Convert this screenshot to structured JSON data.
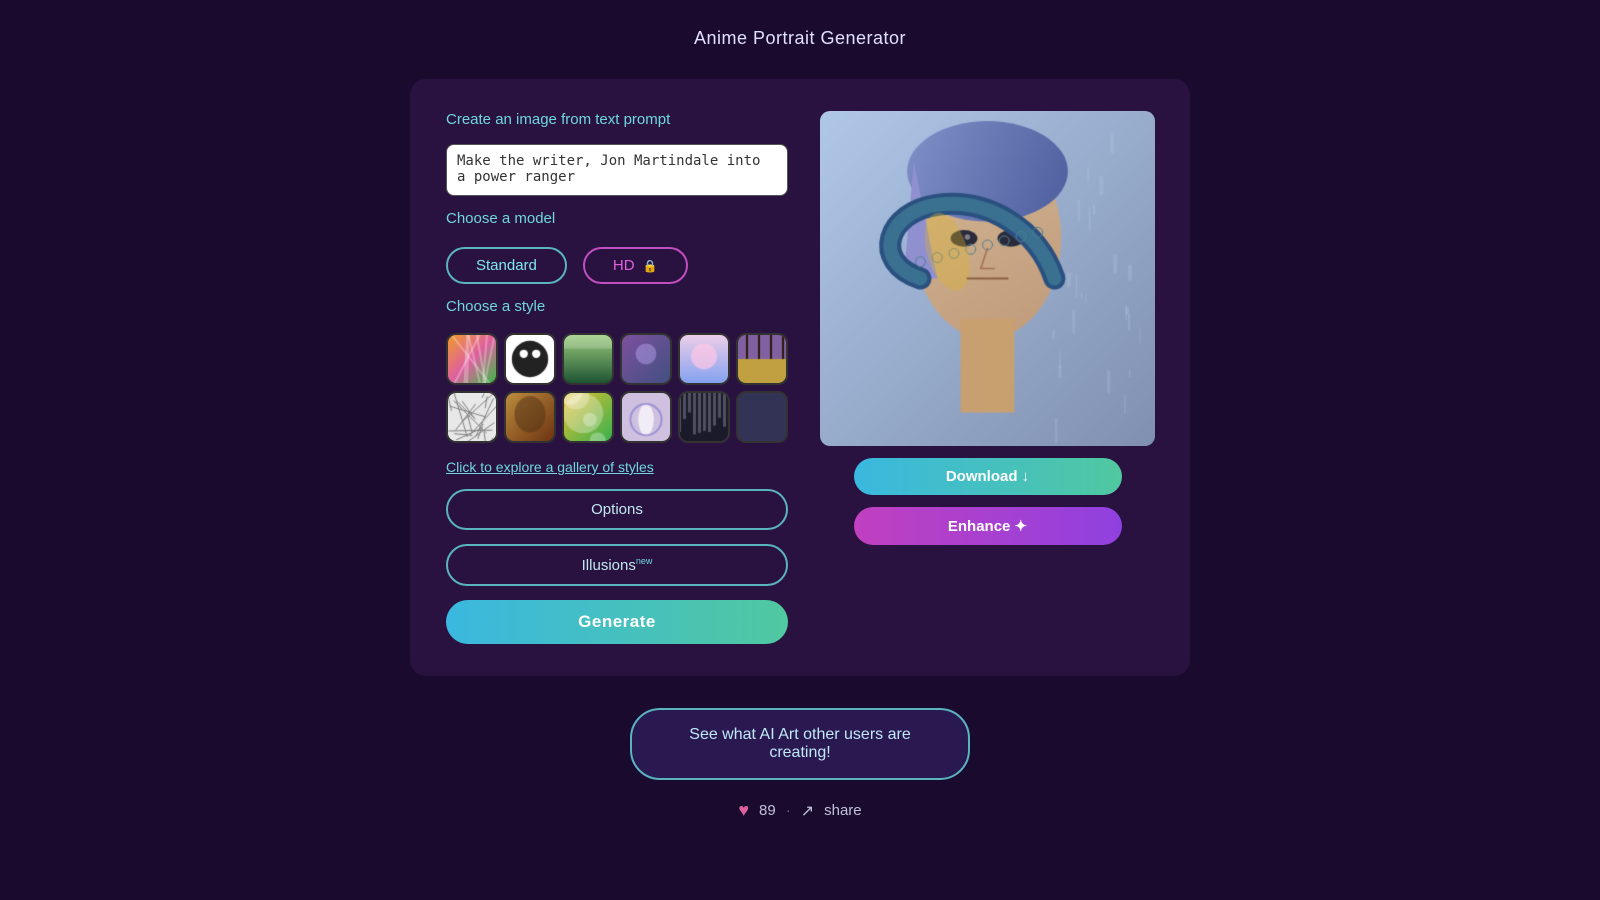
{
  "page": {
    "title": "Anime Portrait Generator"
  },
  "header": {
    "title": "Anime Portrait Generator"
  },
  "form": {
    "section_prompt": "Create an image from text prompt",
    "prompt_value": "Make the writer, Jon Martindale into a power ranger",
    "prompt_placeholder": "Make the writer, Jon Martindale into a power ranger",
    "section_model": "Choose a model",
    "model_standard_label": "Standard",
    "model_hd_label": "HD",
    "model_hd_lock": "🔒",
    "section_style": "Choose a style",
    "gallery_link": "Click to explore a gallery of styles",
    "options_label": "Options",
    "illusions_label": "Illusions",
    "illusions_sup": "new",
    "generate_label": "Generate"
  },
  "output": {
    "download_label": "Download ↓",
    "enhance_label": "Enhance ✦"
  },
  "bottom": {
    "community_label": "See what AI Art other users are creating!",
    "like_count": "89",
    "share_label": "share"
  },
  "styles": [
    {
      "name": "colorful-abstract",
      "color1": "#f0a020",
      "color2": "#30c040"
    },
    {
      "name": "panda",
      "color1": "#ffffff",
      "color2": "#222222"
    },
    {
      "name": "forest",
      "color1": "#2a8040",
      "color2": "#1a5030"
    },
    {
      "name": "warrior",
      "color1": "#8050a0",
      "color2": "#405080"
    },
    {
      "name": "anime-girl",
      "color1": "#f0c0e0",
      "color2": "#80a0f0"
    },
    {
      "name": "castle",
      "color1": "#c0a080",
      "color2": "#806040"
    },
    {
      "name": "sketch-city",
      "color1": "#a0a0a0",
      "color2": "#606060"
    },
    {
      "name": "mona-lisa",
      "color1": "#c09040",
      "color2": "#804020"
    },
    {
      "name": "tropical",
      "color1": "#f0a020",
      "color2": "#30a040"
    },
    {
      "name": "ballet",
      "color1": "#e0b0d0",
      "color2": "#6080c0"
    },
    {
      "name": "gothic-city",
      "color1": "#606080",
      "color2": "#303040"
    },
    {
      "name": "empty",
      "color1": "#333355",
      "color2": "#222244"
    }
  ]
}
